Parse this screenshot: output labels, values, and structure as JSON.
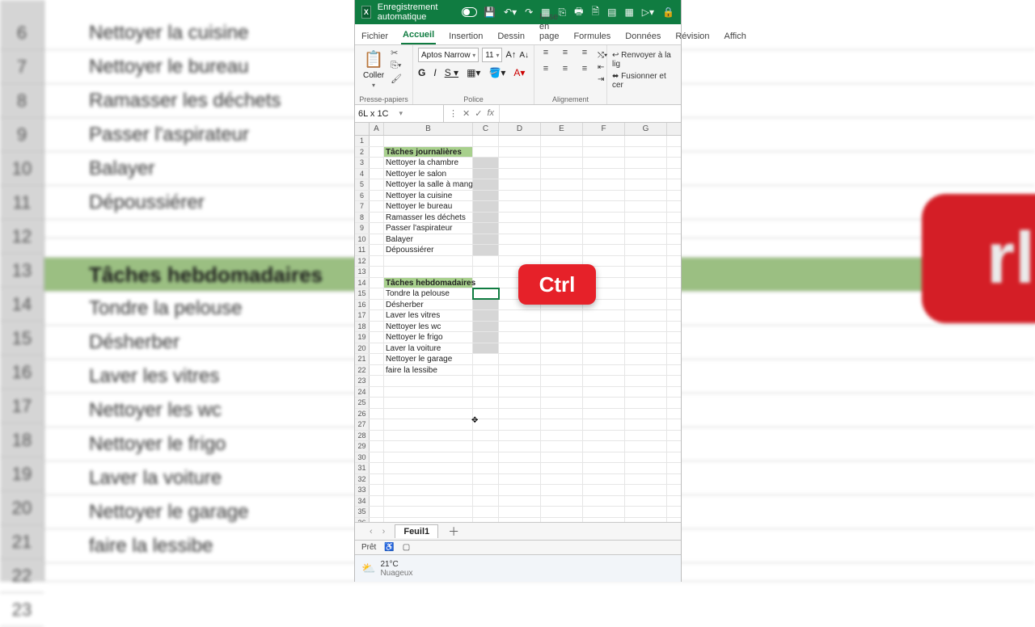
{
  "bg": {
    "row_numbers": [
      "6",
      "7",
      "8",
      "9",
      "10",
      "11",
      "12",
      "13",
      "14",
      "15",
      "16",
      "17",
      "18",
      "19",
      "20",
      "21",
      "22",
      "23"
    ],
    "cells": [
      "Nettoyer la cuisine",
      "Nettoyer le bureau",
      "Ramasser les déchets",
      "Passer l'aspirateur",
      "Balayer",
      "Dépoussiérer",
      "",
      "",
      "Tâches hebdomadaires",
      "Tondre la pelouse",
      "Désherber",
      "Laver les vitres",
      "Nettoyer les wc",
      "Nettoyer le frigo",
      "Laver la voiture",
      "Nettoyer le garage",
      "faire la lessibe",
      ""
    ],
    "header_index": 8,
    "right_label": "rl"
  },
  "titlebar": {
    "autosave": "Enregistrement automatique"
  },
  "tabs": {
    "items": [
      "Fichier",
      "Accueil",
      "Insertion",
      "Dessin",
      "Mise en page",
      "Formules",
      "Données",
      "Révision",
      "Affich"
    ],
    "active_index": 1
  },
  "ribbon": {
    "clipboard": {
      "paste": "Coller",
      "label": "Presse-papiers"
    },
    "font": {
      "name": "Aptos Narrow",
      "size": "11",
      "label": "Police"
    },
    "align": {
      "wrap": "Renvoyer à la lig",
      "merge": "Fusionner et cer",
      "label": "Alignement"
    }
  },
  "fx": {
    "namebox": "6L x 1C"
  },
  "grid": {
    "cols": [
      "A",
      "B",
      "C",
      "D",
      "E",
      "F",
      "G"
    ],
    "rows": [
      {
        "n": "1"
      },
      {
        "n": "2",
        "b": "Tâches journalières",
        "hdr": true
      },
      {
        "n": "3",
        "b": "Nettoyer la chambre",
        "csel": true
      },
      {
        "n": "4",
        "b": "Nettoyer le salon",
        "csel": true
      },
      {
        "n": "5",
        "b": "Nettoyer la salle à manger",
        "csel": true
      },
      {
        "n": "6",
        "b": "Nettoyer la cuisine",
        "csel": true
      },
      {
        "n": "7",
        "b": "Nettoyer le bureau",
        "csel": true
      },
      {
        "n": "8",
        "b": "Ramasser les déchets",
        "csel": true
      },
      {
        "n": "9",
        "b": "Passer l'aspirateur",
        "csel": true
      },
      {
        "n": "10",
        "b": "Balayer",
        "csel": true
      },
      {
        "n": "11",
        "b": "Dépoussiérer",
        "csel": true
      },
      {
        "n": "12"
      },
      {
        "n": "13"
      },
      {
        "n": "14",
        "b": "Tâches hebdomadaires",
        "hdr": true
      },
      {
        "n": "15",
        "b": "Tondre la pelouse",
        "cactive": true
      },
      {
        "n": "16",
        "b": "Désherber",
        "csel": true
      },
      {
        "n": "17",
        "b": "Laver les vitres",
        "csel": true
      },
      {
        "n": "18",
        "b": "Nettoyer les wc",
        "csel": true
      },
      {
        "n": "19",
        "b": "Nettoyer le frigo",
        "csel": true
      },
      {
        "n": "20",
        "b": "Laver la voiture",
        "csel": true
      },
      {
        "n": "21",
        "b": "Nettoyer le garage"
      },
      {
        "n": "22",
        "b": "faire la lessibe"
      },
      {
        "n": "23"
      },
      {
        "n": "24"
      },
      {
        "n": "25"
      },
      {
        "n": "26"
      },
      {
        "n": "27"
      },
      {
        "n": "28"
      },
      {
        "n": "29"
      },
      {
        "n": "30"
      },
      {
        "n": "31"
      },
      {
        "n": "32"
      },
      {
        "n": "33"
      },
      {
        "n": "34"
      },
      {
        "n": "35"
      },
      {
        "n": "36"
      }
    ]
  },
  "sheettabs": {
    "name": "Feuil1"
  },
  "status": {
    "ready": "Prêt"
  },
  "taskbar": {
    "temp": "21°C",
    "cond": "Nuageux"
  },
  "overlay": {
    "ctrl": "Ctrl"
  }
}
